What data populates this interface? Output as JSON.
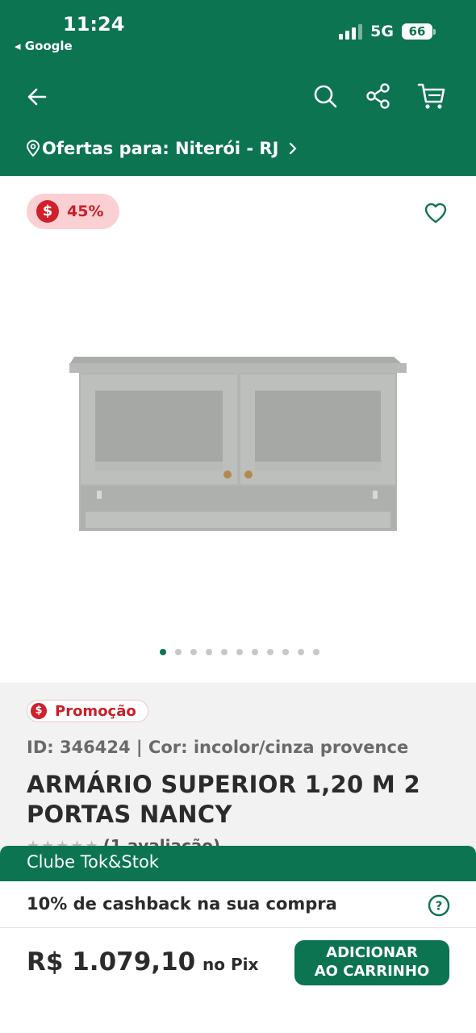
{
  "status_bar": {
    "time": "11:24",
    "back_app": "◂ Google",
    "network": "5G",
    "battery": "66"
  },
  "nav": {
    "location_label": "Ofertas para: Niterói - RJ"
  },
  "gallery": {
    "discount": "45%",
    "coin_symbol": "$",
    "image_count": 11,
    "active_index": 0
  },
  "product": {
    "promo_label": "Promoção",
    "id_color": "ID: 346424 | Cor: incolor/cinza provence",
    "title": "ARMÁRIO SUPERIOR 1,20 M 2 PORTAS NANCY",
    "rating_count": "(1 avaliação)"
  },
  "club": {
    "title": "Clube Tok&Stok",
    "cashback": "10% de cashback na sua compra"
  },
  "purchase": {
    "price": "R$ 1.079,10",
    "price_note": "no Pix",
    "add_button_line1": "ADICIONAR",
    "add_button_line2": "AO CARRINHO"
  },
  "colors": {
    "brand_green": "#0c7450",
    "promo_red": "#d0202b",
    "discount_bg": "#fbd0d3"
  }
}
